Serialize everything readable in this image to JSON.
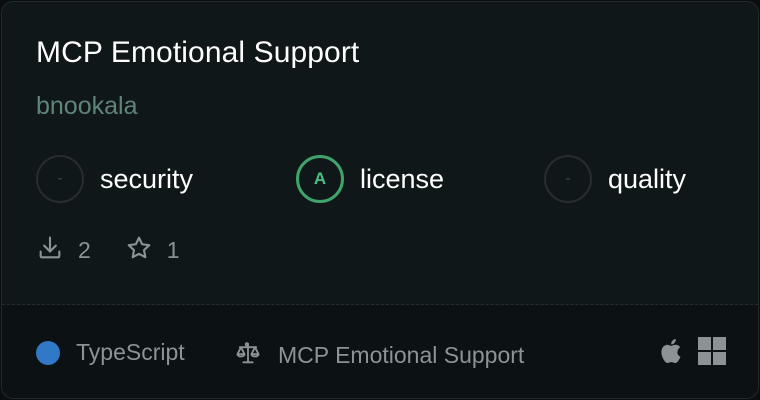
{
  "server": {
    "title": "MCP Emotional Support",
    "author": "bnookala"
  },
  "scores": [
    {
      "grade": "-",
      "label": "security",
      "status": "none"
    },
    {
      "grade": "A",
      "label": "license",
      "status": "good"
    },
    {
      "grade": "-",
      "label": "quality",
      "status": "none"
    }
  ],
  "stats": {
    "downloads": "2",
    "stars": "1",
    "download_icon": "download-icon",
    "star_icon": "star-icon"
  },
  "footer": {
    "language": "TypeScript",
    "language_color": "#3178c6",
    "license_name": "MCP Emotional Support",
    "license_icon": "scale-icon",
    "platforms": [
      "apple-icon",
      "windows-icon"
    ]
  },
  "colors": {
    "grade_good": "#3fa36b",
    "author": "#5f8479",
    "muted_text": "#8b9396"
  }
}
